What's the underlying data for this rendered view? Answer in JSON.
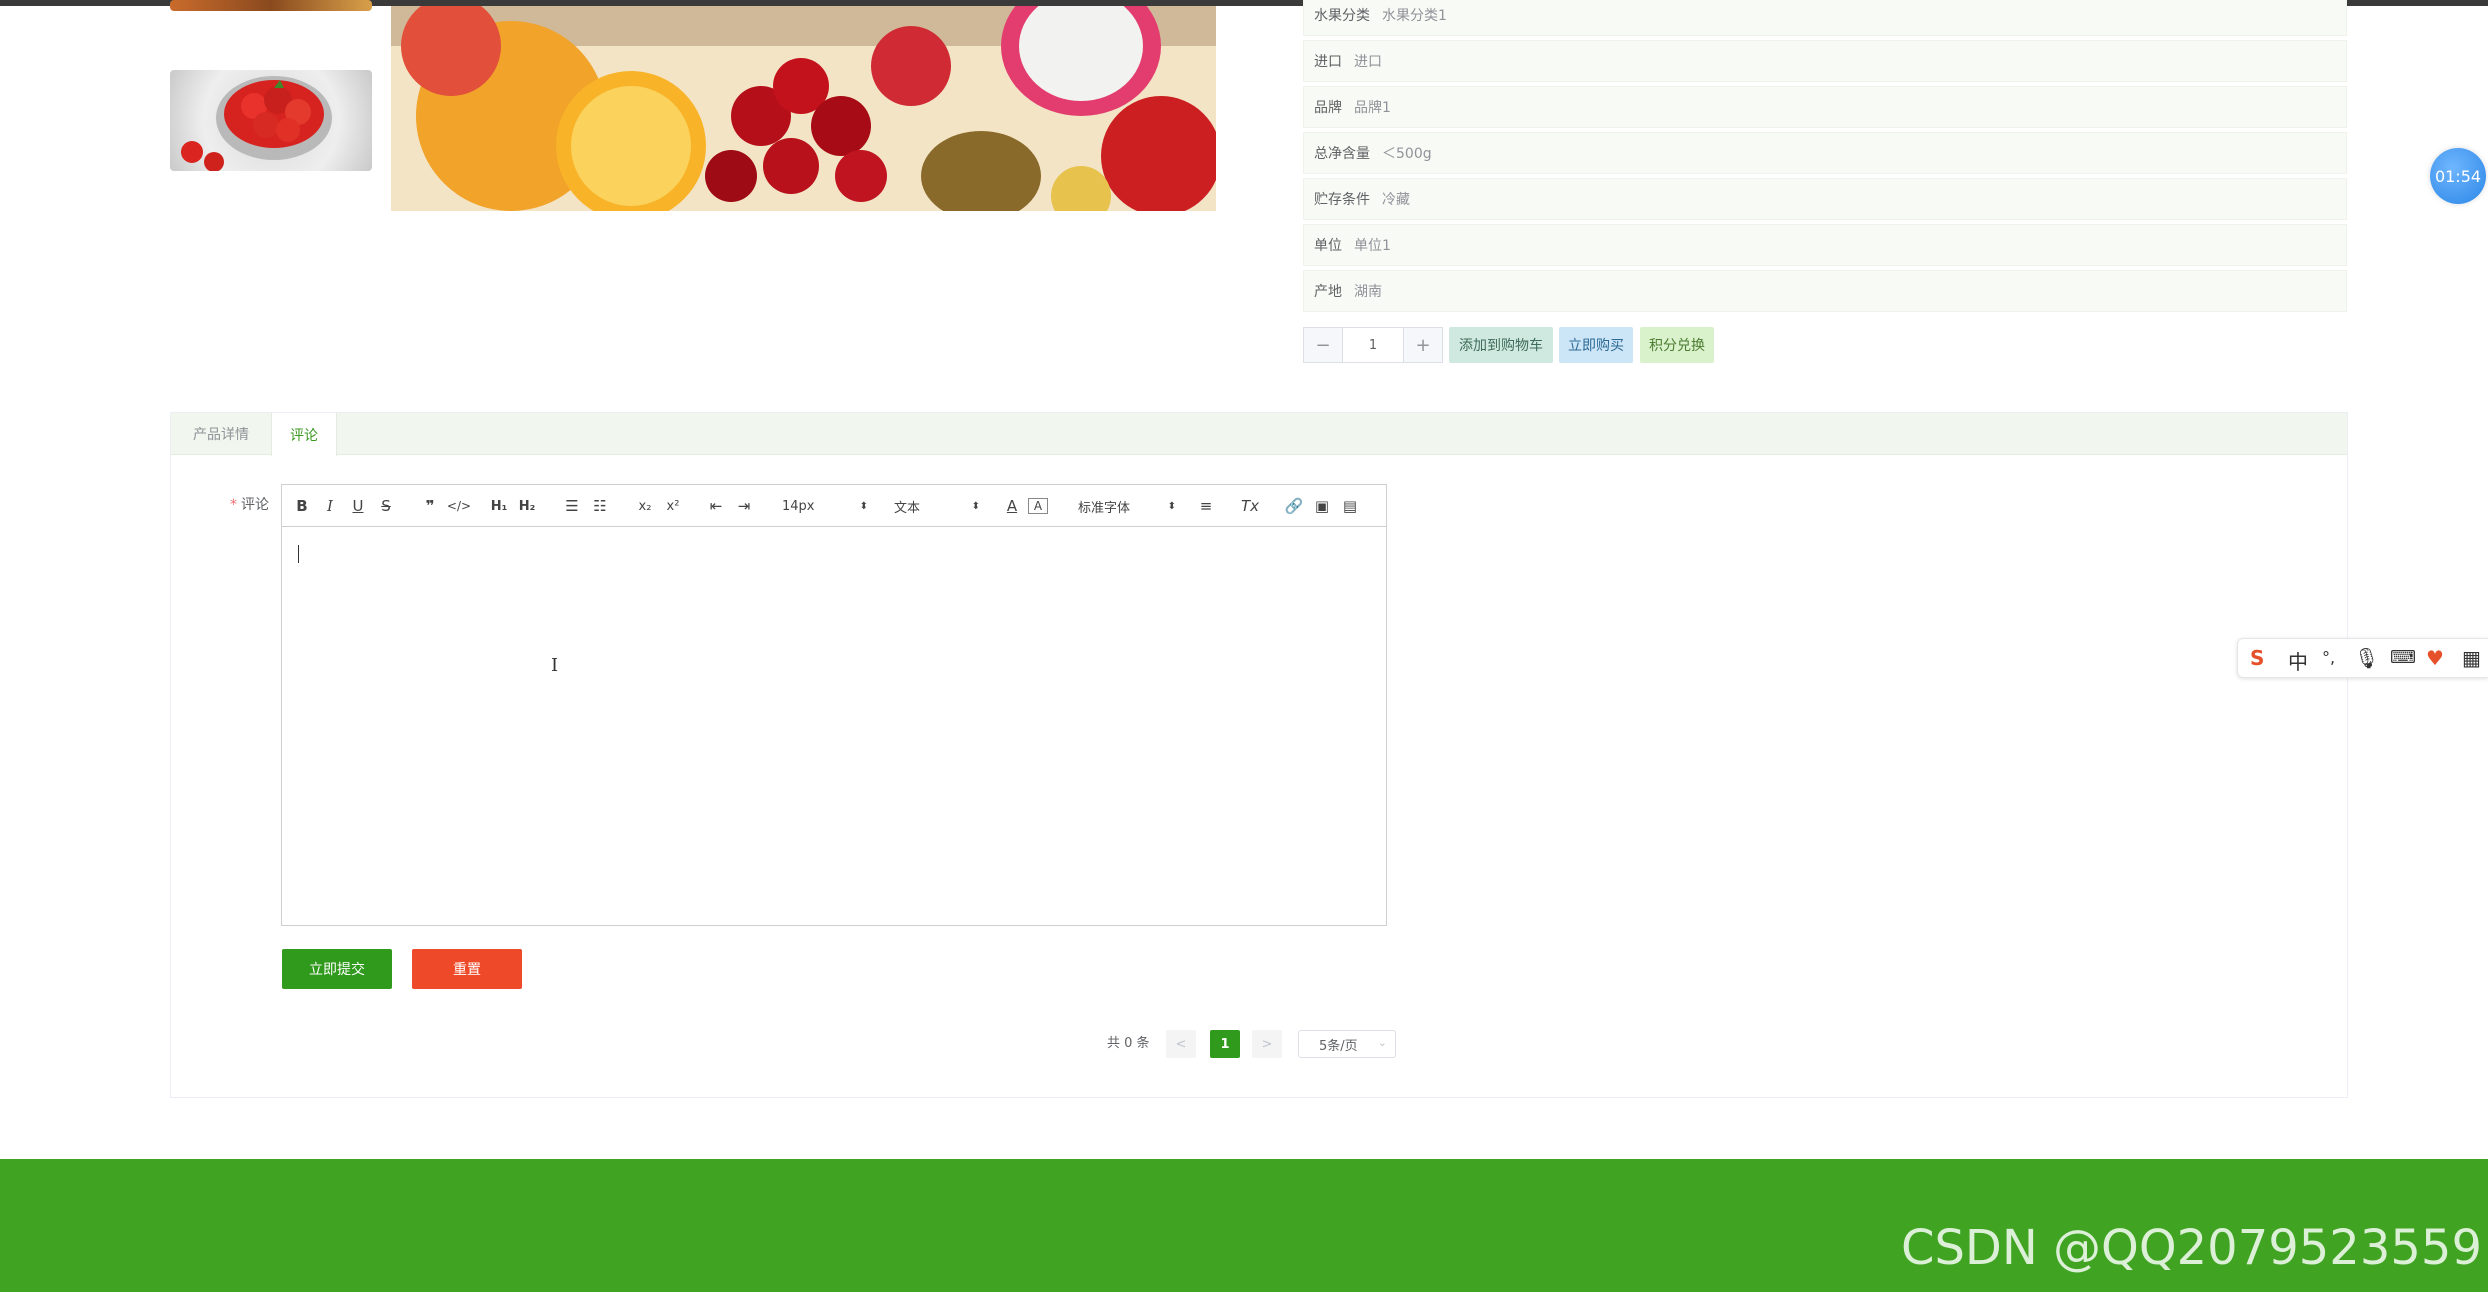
{
  "gallery": {
    "thumb_top_desc": "fruit",
    "thumb_strawberry_desc": "strawberries"
  },
  "specs": [
    {
      "key": "水果分类",
      "value": "水果分类1"
    },
    {
      "key": "进口",
      "value": "进口"
    },
    {
      "key": "品牌",
      "value": "品牌1"
    },
    {
      "key": "总净含量",
      "value": "＜500g"
    },
    {
      "key": "贮存条件",
      "value": "冷藏"
    },
    {
      "key": "单位",
      "value": "单位1"
    },
    {
      "key": "产地",
      "value": "湖南"
    }
  ],
  "quantity": {
    "minus": "−",
    "value": "1",
    "plus": "+"
  },
  "actions": {
    "add_to_cart": "添加到购物车",
    "buy_now": "立即购买",
    "redeem_points": "积分兑换"
  },
  "tabs": {
    "detail": "产品详情",
    "comment": "评论"
  },
  "form": {
    "required_mark": "*",
    "comment_label": "评论"
  },
  "editor": {
    "font_size": "14px",
    "text_style": "文本",
    "font_family": "标准字体"
  },
  "buttons": {
    "submit": "立即提交",
    "reset": "重置"
  },
  "pagination": {
    "total": "共 0 条",
    "prev": "<",
    "current": "1",
    "next": ">",
    "page_size": "5条/页"
  },
  "timer": "01:54",
  "ime": {
    "zh": "中",
    "punct": "°,"
  },
  "watermark": "CSDN @QQ2079523559",
  "colors": {
    "brand_green": "#40a422",
    "primary_green": "#2f9a1c",
    "danger": "#ee4a2a",
    "timer_blue": "#2b86e6"
  }
}
